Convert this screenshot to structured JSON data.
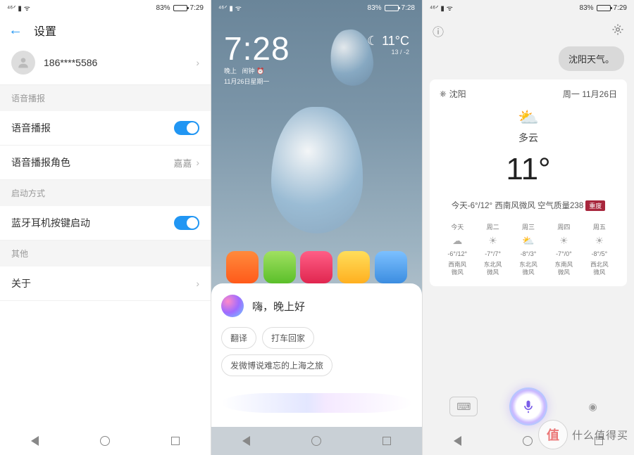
{
  "status": {
    "signal": "4G⁺ ᐟ",
    "wifi": "📶",
    "batt_pct": "83%",
    "time1": "7:29",
    "time2": "7:28",
    "time3": "7:29"
  },
  "s1": {
    "title": "设置",
    "account": "186****5586",
    "sec_voice": "语音播报",
    "row_voice": "语音播报",
    "row_role": "语音播报角色",
    "row_role_val": "嘉嘉",
    "sec_launch": "启动方式",
    "row_bt": "蓝牙耳机按键启动",
    "sec_other": "其他",
    "row_about": "关于"
  },
  "s2": {
    "clock": "7:28",
    "clock_sub1": "晚上",
    "clock_sub2": "闹钟 ⏰",
    "date": "11月26日星期一",
    "home_temp": "☾ 11°C",
    "home_range": "13 / -2",
    "greeting": "嗨，晚上好",
    "chips": [
      "翻译",
      "打车回家",
      "发微博说难忘的上海之旅"
    ],
    "pull": "︿"
  },
  "s3": {
    "query": "沈阳天气。",
    "city": "沈阳",
    "date": "周一 11月26日",
    "cond": "多云",
    "temp": "11°",
    "today_line": "今天-6°/12° 西南风微风 空气质量238",
    "aqi_badge": "重度",
    "forecast": [
      {
        "d": "今天",
        "i": "☁",
        "t": "-6°/12°",
        "w": "西南风微风"
      },
      {
        "d": "周二",
        "i": "☀",
        "t": "-7°/7°",
        "w": "东北风微风"
      },
      {
        "d": "周三",
        "i": "⛅",
        "t": "-8°/3°",
        "w": "东北风微风"
      },
      {
        "d": "周四",
        "i": "☀",
        "t": "-7°/0°",
        "w": "东南风微风"
      },
      {
        "d": "周五",
        "i": "☀",
        "t": "-8°/5°",
        "w": "西北风微风"
      }
    ]
  },
  "wm": "什么值得买"
}
